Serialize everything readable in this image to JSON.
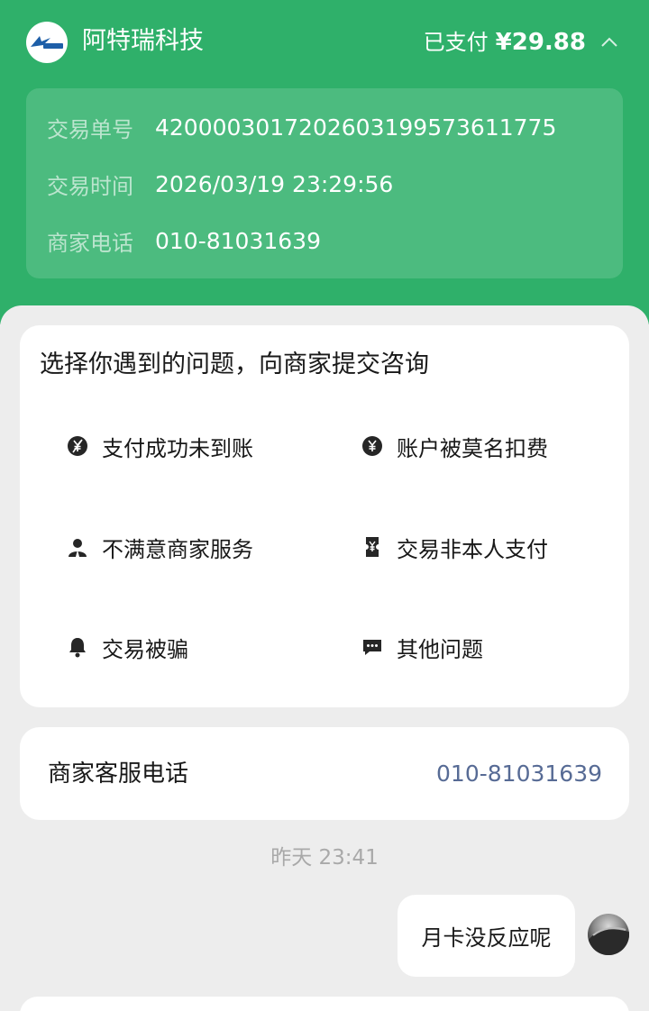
{
  "merchant": {
    "name": "阿特瑞科技",
    "logo_text": "阿特瑞科技"
  },
  "payment": {
    "status": "已支付",
    "amount": "¥29.88"
  },
  "transaction": {
    "rows": [
      {
        "label": "交易单号",
        "value": "4200003017202603199573611775"
      },
      {
        "label": "交易时间",
        "value": "2026/03/19 23:29:56"
      },
      {
        "label": "商家电话",
        "value": "010-81031639"
      }
    ]
  },
  "issues": {
    "title": "选择你遇到的问题，向商家提交咨询",
    "items": [
      {
        "label": "支付成功未到账",
        "icon": "yuan-slash-icon"
      },
      {
        "label": "账户被莫名扣费",
        "icon": "yuan-circle-icon"
      },
      {
        "label": "不满意商家服务",
        "icon": "person-icon"
      },
      {
        "label": "交易非本人支付",
        "icon": "ticket-icon"
      },
      {
        "label": "交易被骗",
        "icon": "bell-icon"
      },
      {
        "label": "其他问题",
        "icon": "chat-bubble-icon"
      }
    ]
  },
  "service_phone": {
    "label": "商家客服电话",
    "value": "010-81031639"
  },
  "chat": {
    "timestamp": "昨天 23:41",
    "messages": [
      {
        "text": "月卡没反应呢"
      }
    ]
  },
  "colors": {
    "header_green": "#2fb06a",
    "link_blue": "#576b95",
    "page_gray": "#ededed"
  }
}
